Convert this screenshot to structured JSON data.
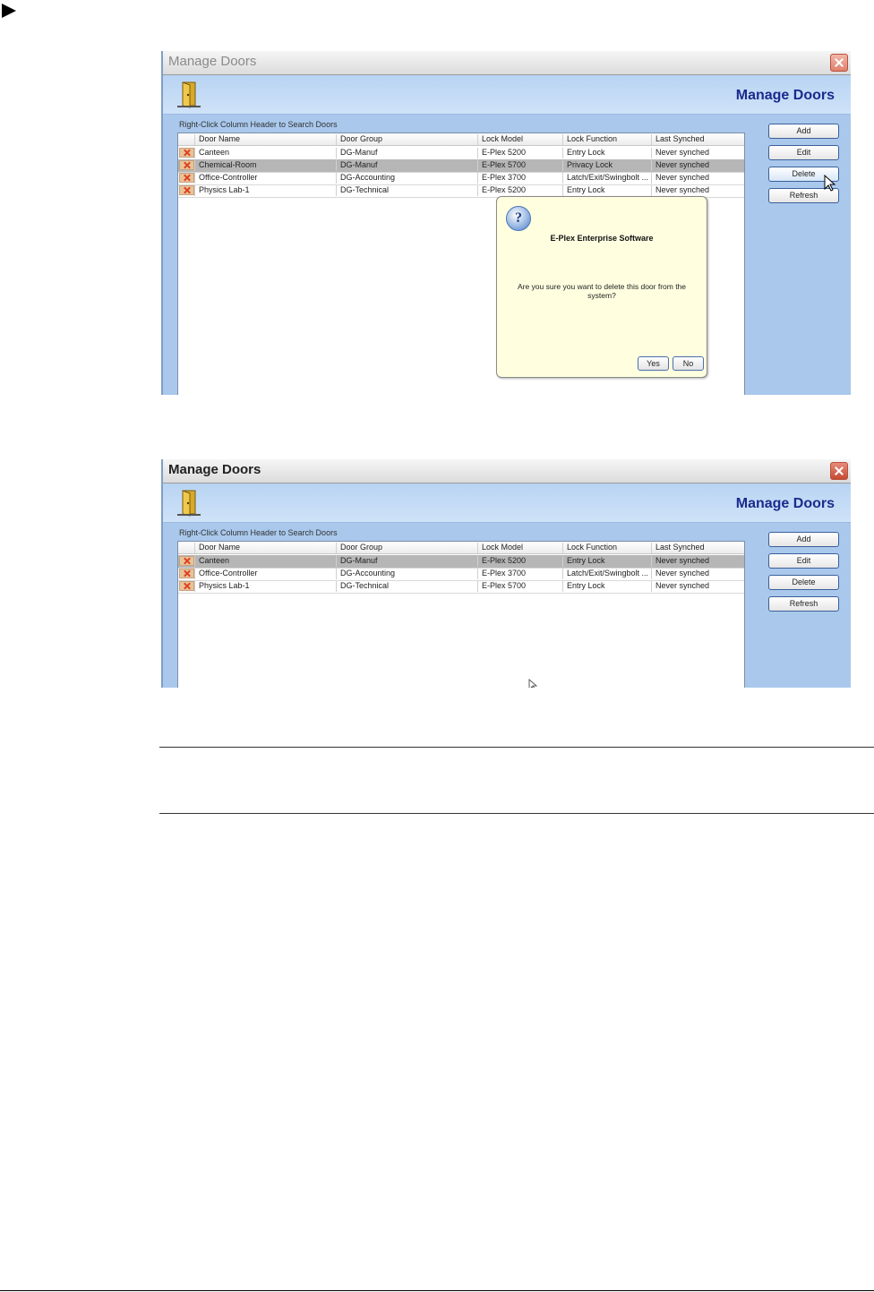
{
  "window1": {
    "title": "Manage Doors",
    "header_title": "Manage Doors",
    "hint": "Right-Click Column Header to Search Doors",
    "columns": [
      "Door Name",
      "Door Group",
      "Lock Model",
      "Lock Function",
      "Last Synched"
    ],
    "rows": [
      [
        "Canteen",
        "DG-Manuf",
        "E-Plex 5200",
        "Entry Lock",
        "Never synched"
      ],
      [
        "Chemical-Room",
        "DG-Manuf",
        "E-Plex 5700",
        "Privacy Lock",
        "Never synched"
      ],
      [
        "Office-Controller",
        "DG-Accounting",
        "E-Plex 3700",
        "Latch/Exit/Swingbolt ...",
        "Never synched"
      ],
      [
        "Physics Lab-1",
        "DG-Technical",
        "E-Plex 5200",
        "Entry Lock",
        "Never synched"
      ]
    ],
    "selected_row": 1,
    "buttons": {
      "add": "Add",
      "edit": "Edit",
      "delete": "Delete",
      "refresh": "Refresh"
    },
    "dialog": {
      "title": "E-Plex Enterprise Software",
      "message": "Are you sure you want to delete this door from the system?",
      "yes": "Yes",
      "no": "No",
      "icon": "question-icon"
    }
  },
  "window2": {
    "title": "Manage Doors",
    "header_title": "Manage Doors",
    "hint": "Right-Click Column Header to Search Doors",
    "columns": [
      "Door Name",
      "Door Group",
      "Lock Model",
      "Lock Function",
      "Last Synched"
    ],
    "rows": [
      [
        "Canteen",
        "DG-Manuf",
        "E-Plex 5200",
        "Entry Lock",
        "Never synched"
      ],
      [
        "Office-Controller",
        "DG-Accounting",
        "E-Plex 3700",
        "Latch/Exit/Swingbolt ...",
        "Never synched"
      ],
      [
        "Physics Lab-1",
        "DG-Technical",
        "E-Plex 5700",
        "Entry Lock",
        "Never synched"
      ]
    ],
    "selected_row": 0,
    "buttons": {
      "add": "Add",
      "edit": "Edit",
      "delete": "Delete",
      "refresh": "Refresh"
    }
  },
  "colors": {
    "window_bg": "#a9c8ec",
    "header_title": "#1b2b8c",
    "selected_row": "#b6b6b6",
    "dialog_bg": "#ffffe0"
  }
}
